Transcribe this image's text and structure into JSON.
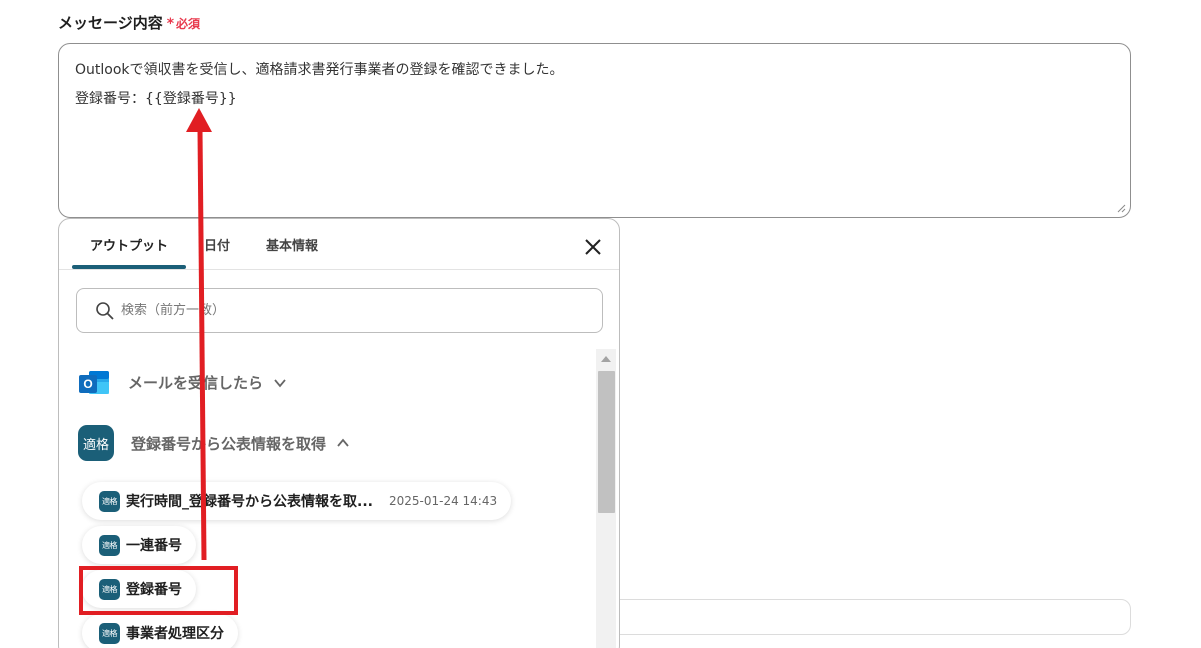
{
  "field": {
    "label": "メッセージ内容",
    "required_mark": "*",
    "required_text": "必須",
    "message_lines": [
      "Outlookで領収書を受信し、適格請求書発行事業者の登録を確認できました。",
      "登録番号：{{登録番号}}"
    ]
  },
  "popup": {
    "tabs": [
      {
        "label": "アウトプット",
        "active": true
      },
      {
        "label": "日付",
        "active": false
      },
      {
        "label": "基本情報",
        "active": false
      }
    ],
    "close_icon": "close-icon",
    "search": {
      "placeholder": "検索（前方一致）",
      "value": "",
      "icon": "search-icon"
    },
    "groups": [
      {
        "title": "メールを受信したら",
        "icon": "outlook-icon",
        "state": "collapsed"
      },
      {
        "title": "登録番号から公表情報を取得",
        "badge": "適格",
        "state": "expanded"
      }
    ],
    "items": [
      {
        "badge": "適格",
        "label": "実行時間_登録番号から公表情報を取...",
        "timestamp": "2025-01-24 14:43"
      },
      {
        "badge": "適格",
        "label": "一連番号",
        "timestamp": ""
      },
      {
        "badge": "適格",
        "label": "登録番号",
        "timestamp": ""
      },
      {
        "badge": "適格",
        "label": "事業者処理区分",
        "timestamp": ""
      }
    ]
  },
  "annotation": {
    "color": "#e11e23",
    "highlighted_item": "登録番号"
  },
  "colors": {
    "accent": "#1b5f78",
    "required": "#e8394d",
    "outlook_blue": "#0f6cbd"
  }
}
